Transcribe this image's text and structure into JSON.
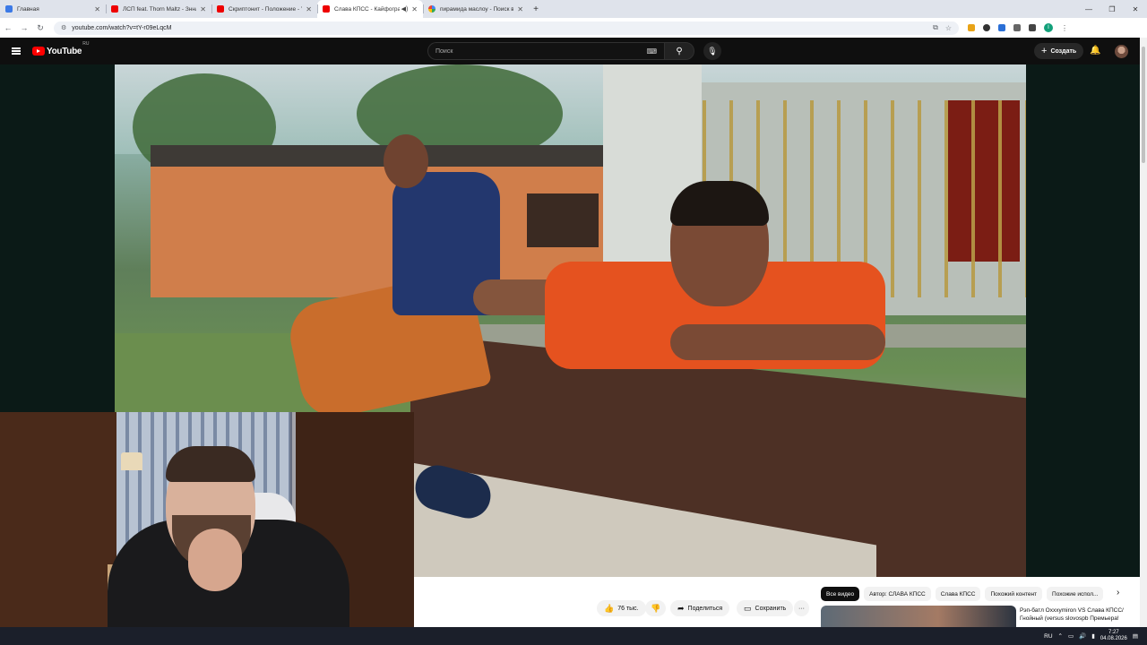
{
  "browser": {
    "tabs": [
      {
        "title": "Главная",
        "icon": "home-favicon-icon",
        "active": false
      },
      {
        "title": "ЛСП feat. Thorn Maltz - Знна...",
        "icon": "youtube-favicon-icon",
        "active": false
      },
      {
        "title": "Скриптонит - Положение - Yo...",
        "icon": "youtube-favicon-icon",
        "active": false
      },
      {
        "title": "Слава КПСС - Кайфоград (...",
        "icon": "youtube-favicon-icon",
        "active": true
      },
      {
        "title": "пирамида маслоу - Поиск в G...",
        "icon": "google-favicon-icon",
        "active": false
      }
    ],
    "url": "youtube.com/watch?v=tY-r09eLqcM"
  },
  "youtube": {
    "logo_text": "YouTube",
    "region": "RU",
    "search_placeholder": "Поиск",
    "create_label": "Создать"
  },
  "actions": {
    "likes": "76 тыс.",
    "share": "Поделиться",
    "save": "Сохранить",
    "more": "···"
  },
  "chips": [
    "Все видео",
    "Автор: СЛАВА КПСС",
    "Слава КПСС",
    "Похожий контент",
    "Похожие испол..."
  ],
  "recommendation": {
    "title": "Рэп-батл Oxxxymiron VS Слава КПСС/ Гнойный (versus slovospb Премьера!"
  },
  "taskbar": {
    "lang": "RU",
    "time": "7:27",
    "date": "04.08.2026"
  },
  "colors": {
    "brand_red": "#ff0000",
    "page_bg": "#0f0f0f"
  }
}
